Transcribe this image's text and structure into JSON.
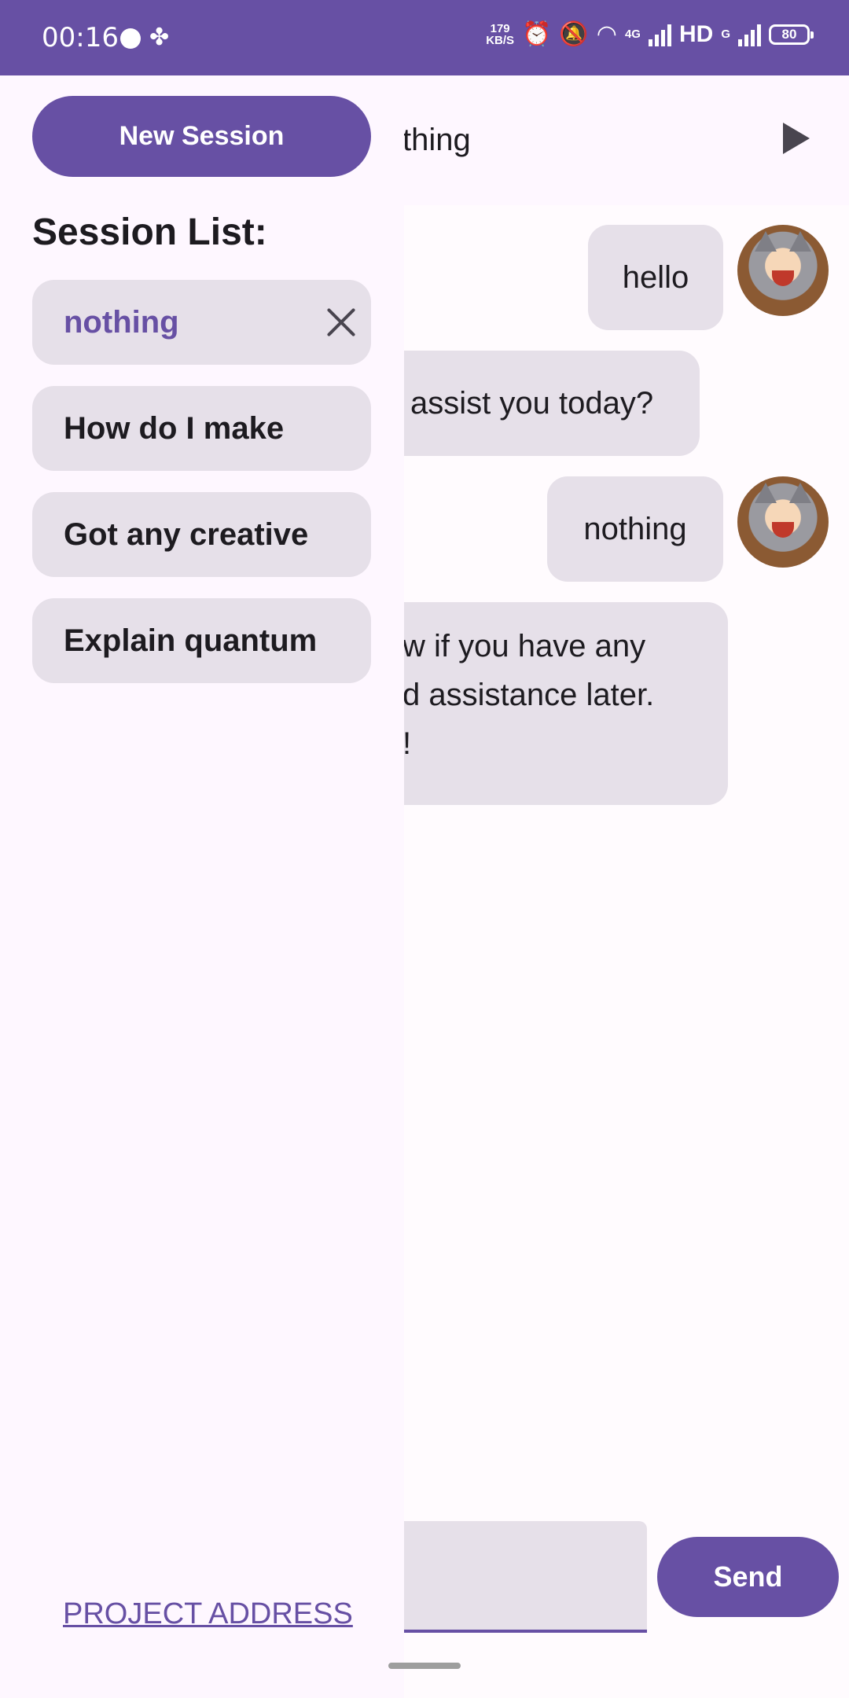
{
  "status_bar": {
    "time": "00:16",
    "net_speed_value": "179",
    "net_speed_unit": "KB/S",
    "network_4g": "4G",
    "hd": "HD",
    "network_g": "G",
    "battery": "80"
  },
  "chat": {
    "title_partial": "thing",
    "messages": [
      {
        "role": "user",
        "text": "hello"
      },
      {
        "role": "assistant",
        "lines": [
          "assist you today?"
        ]
      },
      {
        "role": "user",
        "text": "nothing"
      },
      {
        "role": "assistant",
        "lines": [
          "w if you have any",
          "d assistance later.",
          "!"
        ]
      }
    ],
    "input_value": "",
    "send_label": "Send"
  },
  "drawer": {
    "new_session_label": "New Session",
    "heading": "Session List:",
    "sessions": [
      {
        "title": "nothing",
        "active": true
      },
      {
        "title": "How do I make",
        "active": false
      },
      {
        "title": "Got any creative",
        "active": false
      },
      {
        "title": "Explain quantum",
        "active": false
      }
    ],
    "project_link": "PROJECT ADDRESS"
  },
  "colors": {
    "primary": "#6750a4",
    "surface": "#fef7ff",
    "bubble": "#e6e0e9",
    "on_surface": "#1d1b20"
  },
  "icons": [
    "clover-icon",
    "alarm-icon",
    "mute-icon",
    "wifi-icon",
    "signal-icon",
    "battery-icon",
    "play-icon",
    "close-icon",
    "avatar"
  ]
}
